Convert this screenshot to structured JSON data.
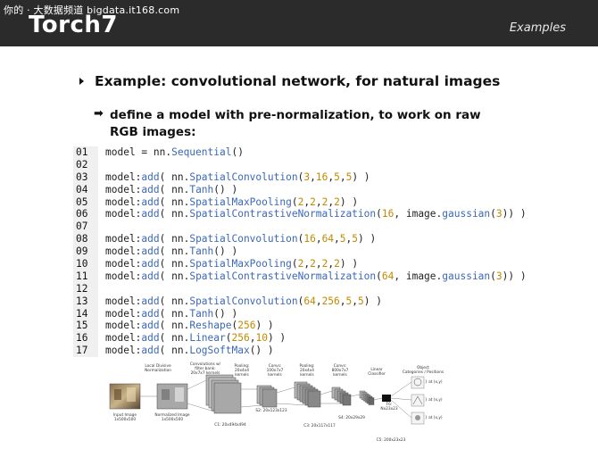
{
  "header": {
    "watermark": "你的 · 大数据频道 bigdata.it168.com",
    "logo": "Torch7",
    "section": "Examples"
  },
  "bullets": {
    "main": "Example: convolutional network, for natural images",
    "sub": "define a model with pre-normalization, to work on raw RGB images:"
  },
  "code": [
    {
      "n": "01",
      "tokens": [
        [
          "t",
          "model = nn."
        ],
        [
          "k",
          "Sequential"
        ],
        [
          "t",
          "()"
        ]
      ]
    },
    {
      "n": "02",
      "tokens": []
    },
    {
      "n": "03",
      "tokens": [
        [
          "t",
          "model:"
        ],
        [
          "k",
          "add"
        ],
        [
          "t",
          "( nn."
        ],
        [
          "k",
          "SpatialConvolution"
        ],
        [
          "t",
          "("
        ],
        [
          "n",
          "3"
        ],
        [
          "t",
          ","
        ],
        [
          "n",
          "16"
        ],
        [
          "t",
          ","
        ],
        [
          "n",
          "5"
        ],
        [
          "t",
          ","
        ],
        [
          "n",
          "5"
        ],
        [
          "t",
          ") )"
        ]
      ]
    },
    {
      "n": "04",
      "tokens": [
        [
          "t",
          "model:"
        ],
        [
          "k",
          "add"
        ],
        [
          "t",
          "( nn."
        ],
        [
          "k",
          "Tanh"
        ],
        [
          "t",
          "() )"
        ]
      ]
    },
    {
      "n": "05",
      "tokens": [
        [
          "t",
          "model:"
        ],
        [
          "k",
          "add"
        ],
        [
          "t",
          "( nn."
        ],
        [
          "k",
          "SpatialMaxPooling"
        ],
        [
          "t",
          "("
        ],
        [
          "n",
          "2"
        ],
        [
          "t",
          ","
        ],
        [
          "n",
          "2"
        ],
        [
          "t",
          ","
        ],
        [
          "n",
          "2"
        ],
        [
          "t",
          ","
        ],
        [
          "n",
          "2"
        ],
        [
          "t",
          ") )"
        ]
      ]
    },
    {
      "n": "06",
      "tokens": [
        [
          "t",
          "model:"
        ],
        [
          "k",
          "add"
        ],
        [
          "t",
          "( nn."
        ],
        [
          "k",
          "SpatialContrastiveNormalization"
        ],
        [
          "t",
          "("
        ],
        [
          "n",
          "16"
        ],
        [
          "t",
          ", image."
        ],
        [
          "k",
          "gaussian"
        ],
        [
          "t",
          "("
        ],
        [
          "n",
          "3"
        ],
        [
          "t",
          ")) )"
        ]
      ]
    },
    {
      "n": "07",
      "tokens": []
    },
    {
      "n": "08",
      "tokens": [
        [
          "t",
          "model:"
        ],
        [
          "k",
          "add"
        ],
        [
          "t",
          "( nn."
        ],
        [
          "k",
          "SpatialConvolution"
        ],
        [
          "t",
          "("
        ],
        [
          "n",
          "16"
        ],
        [
          "t",
          ","
        ],
        [
          "n",
          "64"
        ],
        [
          "t",
          ","
        ],
        [
          "n",
          "5"
        ],
        [
          "t",
          ","
        ],
        [
          "n",
          "5"
        ],
        [
          "t",
          ") )"
        ]
      ]
    },
    {
      "n": "09",
      "tokens": [
        [
          "t",
          "model:"
        ],
        [
          "k",
          "add"
        ],
        [
          "t",
          "( nn."
        ],
        [
          "k",
          "Tanh"
        ],
        [
          "t",
          "() )"
        ]
      ]
    },
    {
      "n": "10",
      "tokens": [
        [
          "t",
          "model:"
        ],
        [
          "k",
          "add"
        ],
        [
          "t",
          "( nn."
        ],
        [
          "k",
          "SpatialMaxPooling"
        ],
        [
          "t",
          "("
        ],
        [
          "n",
          "2"
        ],
        [
          "t",
          ","
        ],
        [
          "n",
          "2"
        ],
        [
          "t",
          ","
        ],
        [
          "n",
          "2"
        ],
        [
          "t",
          ","
        ],
        [
          "n",
          "2"
        ],
        [
          "t",
          ") )"
        ]
      ]
    },
    {
      "n": "11",
      "tokens": [
        [
          "t",
          "model:"
        ],
        [
          "k",
          "add"
        ],
        [
          "t",
          "( nn."
        ],
        [
          "k",
          "SpatialContrastiveNormalization"
        ],
        [
          "t",
          "("
        ],
        [
          "n",
          "64"
        ],
        [
          "t",
          ", image."
        ],
        [
          "k",
          "gaussian"
        ],
        [
          "t",
          "("
        ],
        [
          "n",
          "3"
        ],
        [
          "t",
          ")) )"
        ]
      ]
    },
    {
      "n": "12",
      "tokens": []
    },
    {
      "n": "13",
      "tokens": [
        [
          "t",
          "model:"
        ],
        [
          "k",
          "add"
        ],
        [
          "t",
          "( nn."
        ],
        [
          "k",
          "SpatialConvolution"
        ],
        [
          "t",
          "("
        ],
        [
          "n",
          "64"
        ],
        [
          "t",
          ","
        ],
        [
          "n",
          "256"
        ],
        [
          "t",
          ","
        ],
        [
          "n",
          "5"
        ],
        [
          "t",
          ","
        ],
        [
          "n",
          "5"
        ],
        [
          "t",
          ") )"
        ]
      ]
    },
    {
      "n": "14",
      "tokens": [
        [
          "t",
          "model:"
        ],
        [
          "k",
          "add"
        ],
        [
          "t",
          "( nn."
        ],
        [
          "k",
          "Tanh"
        ],
        [
          "t",
          "() )"
        ]
      ]
    },
    {
      "n": "15",
      "tokens": [
        [
          "t",
          "model:"
        ],
        [
          "k",
          "add"
        ],
        [
          "t",
          "( nn."
        ],
        [
          "k",
          "Reshape"
        ],
        [
          "t",
          "("
        ],
        [
          "n",
          "256"
        ],
        [
          "t",
          ") )"
        ]
      ]
    },
    {
      "n": "16",
      "tokens": [
        [
          "t",
          "model:"
        ],
        [
          "k",
          "add"
        ],
        [
          "t",
          "( nn."
        ],
        [
          "k",
          "Linear"
        ],
        [
          "t",
          "("
        ],
        [
          "n",
          "256"
        ],
        [
          "t",
          ","
        ],
        [
          "n",
          "10"
        ],
        [
          "t",
          ") )"
        ]
      ]
    },
    {
      "n": "17",
      "tokens": [
        [
          "t",
          "model:"
        ],
        [
          "k",
          "add"
        ],
        [
          "t",
          "( nn."
        ],
        [
          "k",
          "LogSoftMax"
        ],
        [
          "t",
          "() )"
        ]
      ]
    }
  ],
  "figure": {
    "labels": {
      "lcn": "Local Divisive\nNormalization",
      "conv1": "Convolutions w/\nfilter bank:\n20x7x7 kernels",
      "pool1": "Pooling:\n20x4x4\nkernels",
      "conv2": "Convs:\n100x7x7\nkernels",
      "pool2": "Pooling:\n20x4x4\nkernels",
      "conv3": "Convs:\n800x7x7\nkernels",
      "linear": "Linear\nClassifier",
      "object": "Object\nCategories / Positions",
      "input": "Input Image\n1x500x500",
      "norm": "Normalized Image\n1x500x500",
      "c1": "C1: 20x494x494",
      "s2": "S2: 20x123x123",
      "c3": "C3: 20x117x117",
      "s4": "S4: 20x29x29",
      "f6": "F6:\nNx23x23",
      "c5": "C5: 200x23x23",
      "out1": "} at (x,y)",
      "out2": "} at (x,y)",
      "out3": "} at (x,y)"
    }
  }
}
